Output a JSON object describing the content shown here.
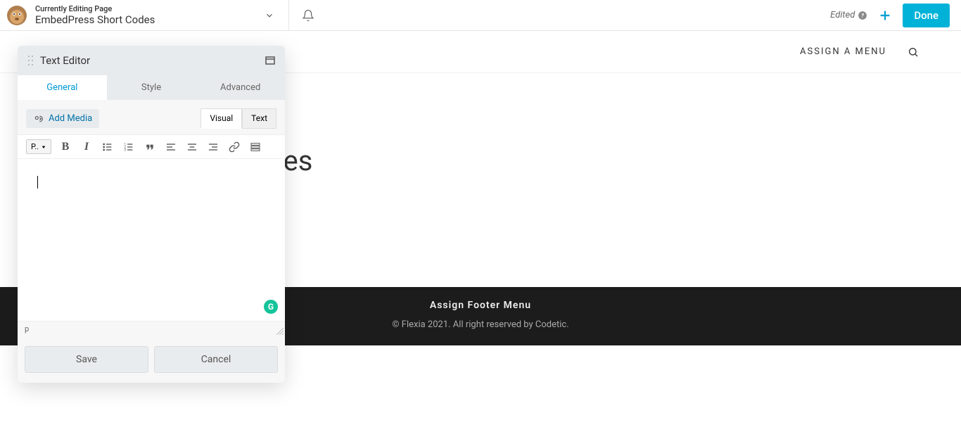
{
  "topbar": {
    "subtitle": "Currently Editing Page",
    "title": "EmbedPress Short Codes",
    "edited_label": "Edited",
    "done_label": "Done"
  },
  "menubar": {
    "assign_menu": "ASSIGN A MENU"
  },
  "page": {
    "heading_fragment": "des"
  },
  "editor": {
    "panel_title": "Text Editor",
    "tabs": {
      "general": "General",
      "style": "Style",
      "advanced": "Advanced"
    },
    "add_media": "Add Media",
    "mode_visual": "Visual",
    "mode_text": "Text",
    "format_dropdown": "P..",
    "status_path": "p",
    "save": "Save",
    "cancel": "Cancel"
  },
  "footer": {
    "assign_label": "Assign Footer Menu",
    "copyright": "© Flexia 2021. All right reserved by Codetic."
  }
}
